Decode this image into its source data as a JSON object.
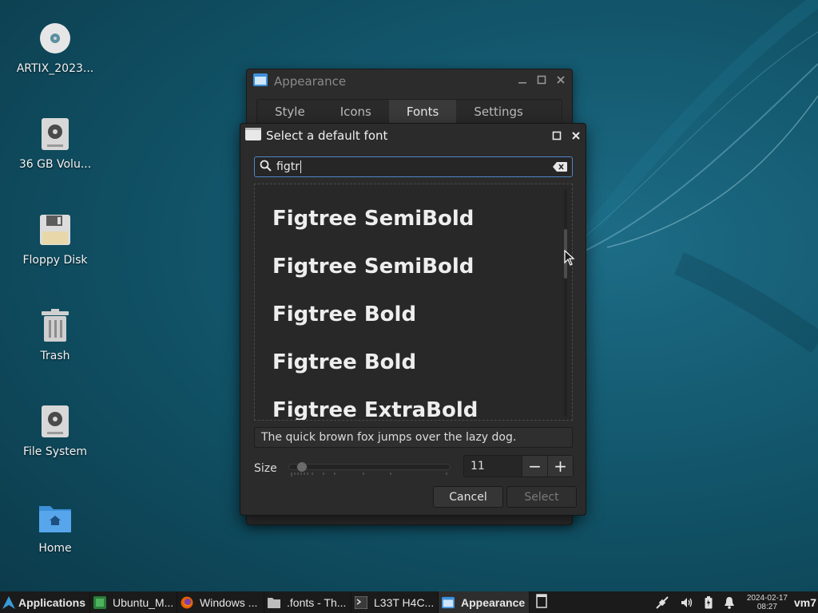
{
  "desktop": {
    "icons": [
      {
        "label": "ARTIX_2023...",
        "icon": "disc-icon"
      },
      {
        "label": "36 GB Volu...",
        "icon": "drive-icon"
      },
      {
        "label": "Floppy Disk",
        "icon": "floppy-icon"
      },
      {
        "label": "Trash",
        "icon": "trash-icon"
      },
      {
        "label": "File System",
        "icon": "drive-icon"
      },
      {
        "label": "Home",
        "icon": "home-folder-icon"
      }
    ]
  },
  "appearance_window": {
    "title": "Appearance",
    "tabs": [
      {
        "label": "Style",
        "active": false
      },
      {
        "label": "Icons",
        "active": false
      },
      {
        "label": "Fonts",
        "active": true
      },
      {
        "label": "Settings",
        "active": false
      }
    ]
  },
  "font_dialog": {
    "title": "Select a default font",
    "search_value": "figtr",
    "fonts": [
      {
        "label": "Figtree SemiBold",
        "weight": "semibold"
      },
      {
        "label": "Figtree SemiBold",
        "weight": "semibold"
      },
      {
        "label": "Figtree Bold",
        "weight": "bold"
      },
      {
        "label": "Figtree Bold",
        "weight": "bold"
      },
      {
        "label": "Figtree ExtraBold",
        "weight": "extrabold"
      }
    ],
    "preview_text": "The quick brown fox jumps over the lazy dog.",
    "size_label": "Size",
    "size_value": "11",
    "minus_label": "−",
    "plus_label": "+",
    "cancel_label": "Cancel",
    "select_label": "Select"
  },
  "taskbar": {
    "start_label": "Applications",
    "items": [
      {
        "label": "Ubuntu_M...",
        "icon": "terminal-green-icon",
        "active": false
      },
      {
        "label": "Windows ...",
        "icon": "firefox-icon",
        "active": false
      },
      {
        "label": ".fonts - Th...",
        "icon": "folder-icon",
        "active": false
      },
      {
        "label": "L33T H4C...",
        "icon": "terminal-icon",
        "active": false
      },
      {
        "label": "Appearance",
        "icon": "appearance-icon",
        "active": true
      }
    ],
    "clock_date": "2024-02-17",
    "clock_time": "08:27",
    "user": "vm7"
  },
  "colors": {
    "accent": "#4f86c6",
    "window_bg": "#2b2b2b",
    "taskbar_bg": "#1b1b1b"
  }
}
